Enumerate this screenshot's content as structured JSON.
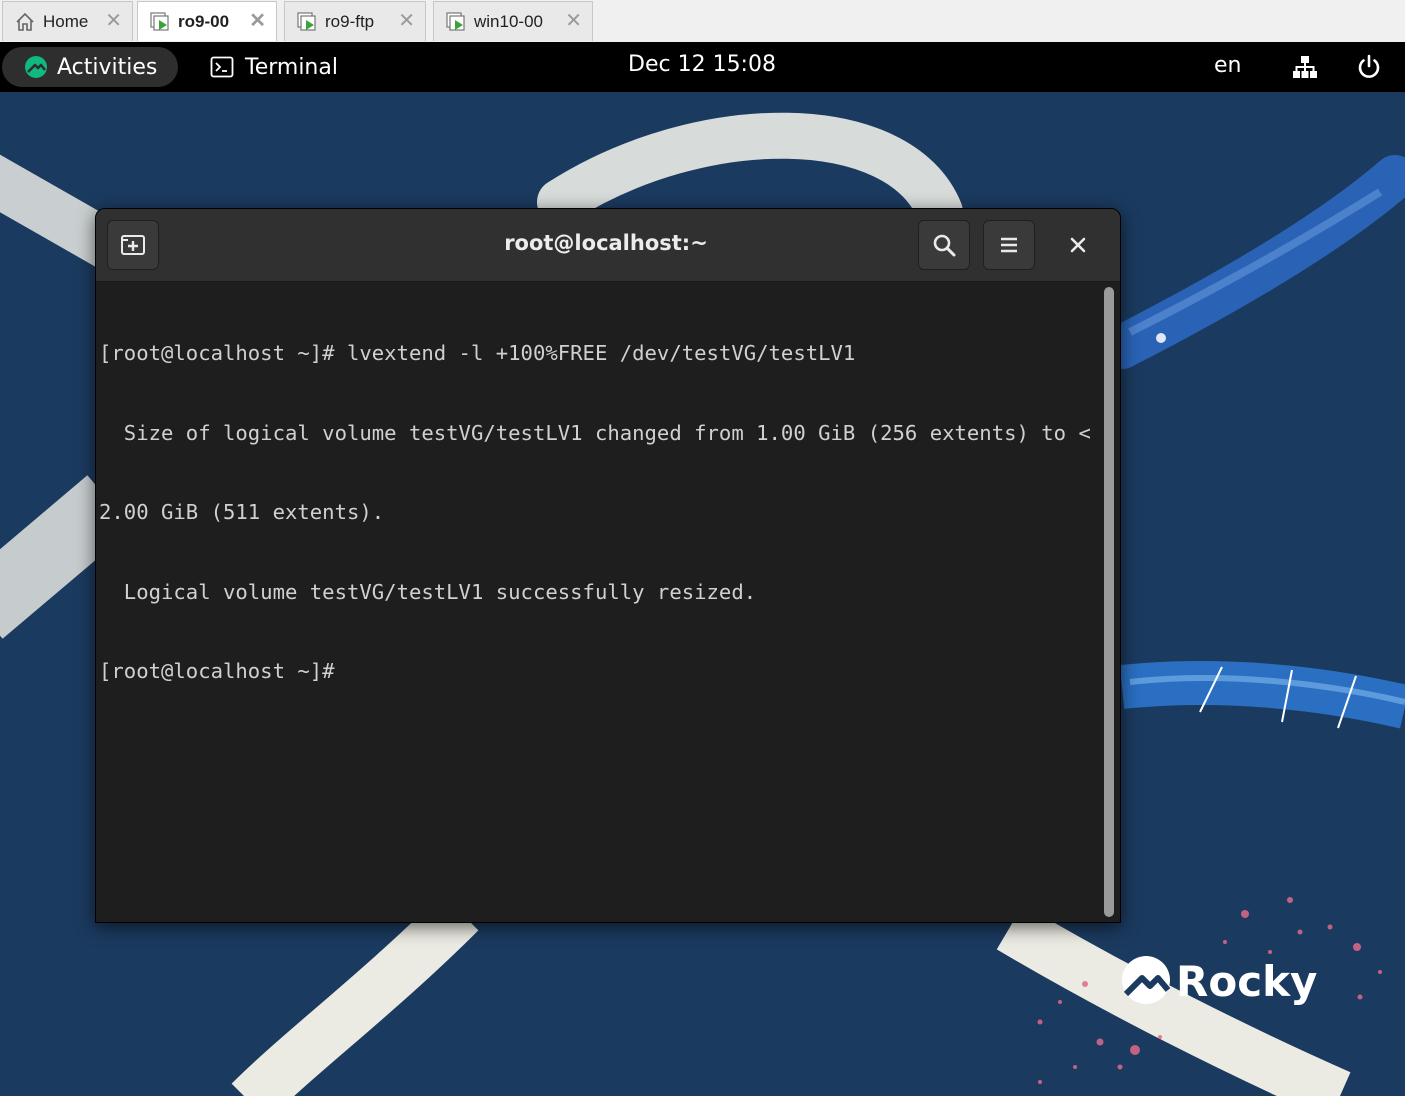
{
  "vmware_tabs": [
    {
      "label": "Home",
      "icon": "home-icon",
      "active": false
    },
    {
      "label": "ro9-00",
      "icon": "vm-running-icon",
      "active": true
    },
    {
      "label": "ro9-ftp",
      "icon": "vm-running-icon",
      "active": false
    },
    {
      "label": "win10-00",
      "icon": "vm-running-icon",
      "active": false
    }
  ],
  "tab_close_glyph": "✕",
  "topbar": {
    "activities_label": "Activities",
    "app_label": "Terminal",
    "clock": "Dec 12  15:08",
    "language": "en"
  },
  "terminal": {
    "title": "root@localhost:~",
    "lines": [
      "[root@localhost ~]# lvextend -l +100%FREE /dev/testVG/testLV1",
      "  Size of logical volume testVG/testLV1 changed from 1.00 GiB (256 extents) to <",
      "2.00 GiB (511 extents).",
      "  Logical volume testVG/testLV1 successfully resized.",
      "[root@localhost ~]# "
    ]
  },
  "wallpaper_brand": "Rocky",
  "colors": {
    "desktop_bg": "#1b3a5f",
    "topbar_bg": "#000000",
    "terminal_bg": "#1e1e1e",
    "headerbar_bg": "#303030",
    "rocky_green": "#10b981",
    "vm_green": "#3aa33a"
  }
}
